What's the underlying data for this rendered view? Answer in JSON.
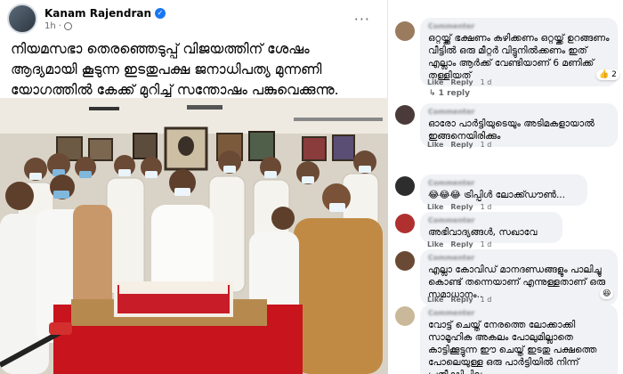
{
  "post": {
    "author": "Kanam Rajendran",
    "time": "1h",
    "privacy_icon": "globe-icon",
    "more_label": "···",
    "text": "നിയമസഭാ തെരഞ്ഞെടുപ്പ് വിജയത്തിന് ശേഷം ആദ്യമായി കൂടുന്ന ഇടതുപക്ഷ ജനാധിപത്യ മുന്നണി യോഗത്തിൽ കേക്ക് മുറിച്ച് സന്തോഷം പങ്കുവെക്കുന്നു."
  },
  "comments": [
    {
      "author": "Commenter",
      "text": "ഒറ്റയ്ക്ക് ഭക്ഷണം കഴിക്കണം ഒറ്റയ്ക്ക് ഉറങ്ങണം വീട്ടിൽ ഒരു മീറ്റർ വിട്ടുനിൽക്കണം ഇത് എല്ലാം ആർക്ക് വേണ്ടിയാണ് 6 മണിക്ക് തള്ളിയത്",
      "like": "Like",
      "reply": "Reply",
      "time": "1 d",
      "reaction": "👍 2",
      "replies": "↳ 1 reply"
    },
    {
      "author": "Commenter",
      "text": "ഓരോ പാർട്ടിയുടെയും അടിമകളായാൽ ഇങ്ങനെയിരിക്കും",
      "like": "Like",
      "reply": "Reply",
      "time": "1 d"
    },
    {
      "author": "Commenter",
      "text": "😂😂😂 ട്രിപ്പിൾ ലോക്ക്ഡൗൺ...",
      "like": "Like",
      "reply": "Reply",
      "time": "1 d"
    },
    {
      "author": "Commenter",
      "text": "അഭിവാദ്യങ്ങൾ, സഖാവേ",
      "like": "Like",
      "reply": "Reply",
      "time": "1 d"
    },
    {
      "author": "Commenter",
      "text": "എല്ലാ കോവിഡ് മാനദണ്ഡങ്ങളും പാലിച്ചു കൊണ്ട് തന്നെയാണ് എന്നുള്ളതാണ് ഒരു സമാധാനം..",
      "like": "Like",
      "reply": "Reply",
      "time": "1 d",
      "reaction": "😆"
    },
    {
      "author": "Commenter",
      "text": "വോട്ട് ചെയ്ത് നേരത്തെ ലോക്കാക്കി സാമൂഹിക അകലം പോലുമില്ലാതെ കാട്ടിക്കൂട്ടുന്ന ഈ ചെയ്ത് ഇടതു പക്ഷത്തെ പോലെയുള്ള ഒരു പാർട്ടിയിൽ നിന്ന് പ്രതീക്ഷിച്ചില്ല"
    }
  ]
}
